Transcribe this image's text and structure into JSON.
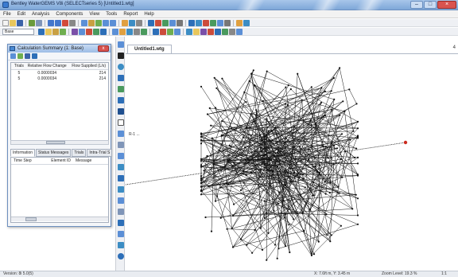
{
  "window": {
    "title": "Bentley WaterGEMS V8i (SELECTseries 5) [Untitled1.wtg]"
  },
  "menu": [
    "File",
    "Edit",
    "Analysis",
    "Components",
    "View",
    "Tools",
    "Report",
    "Help"
  ],
  "toolbar": {
    "scenario_combo": "Base"
  },
  "document": {
    "tab_label": "Untitled1.wtg",
    "scroll_marker": "4"
  },
  "calc_summary": {
    "title": "Calculation Summary (1: Base)",
    "close_glyph": "x",
    "columns": [
      "Trials",
      "Relative Flow Change",
      "Flow Supplied (L/s)"
    ],
    "rows": [
      {
        "trials": "5",
        "relative_flow_change": "0.0000034",
        "flow_supplied": "214"
      },
      {
        "trials": "5",
        "relative_flow_change": "0.0000034",
        "flow_supplied": "214"
      }
    ],
    "tabs": [
      "Information",
      "Status Messages",
      "Trials",
      "Intra-Trial S"
    ],
    "active_tab": "Information",
    "message_columns": [
      "Time Step",
      "Element ID",
      "Message"
    ]
  },
  "drawing_label": "R-1 ...",
  "status": {
    "version": "Version: 8i 5.0(5)",
    "coords": "X: 7.6ft  m, Y: 3.45 m",
    "zoom": "Zoom Level: 19.3 %",
    "page": "1:1"
  },
  "colors": {
    "link": "#111111",
    "node": "#111111",
    "reservoir": "#cc2b1f",
    "titlebar": "#8fb3e0"
  }
}
